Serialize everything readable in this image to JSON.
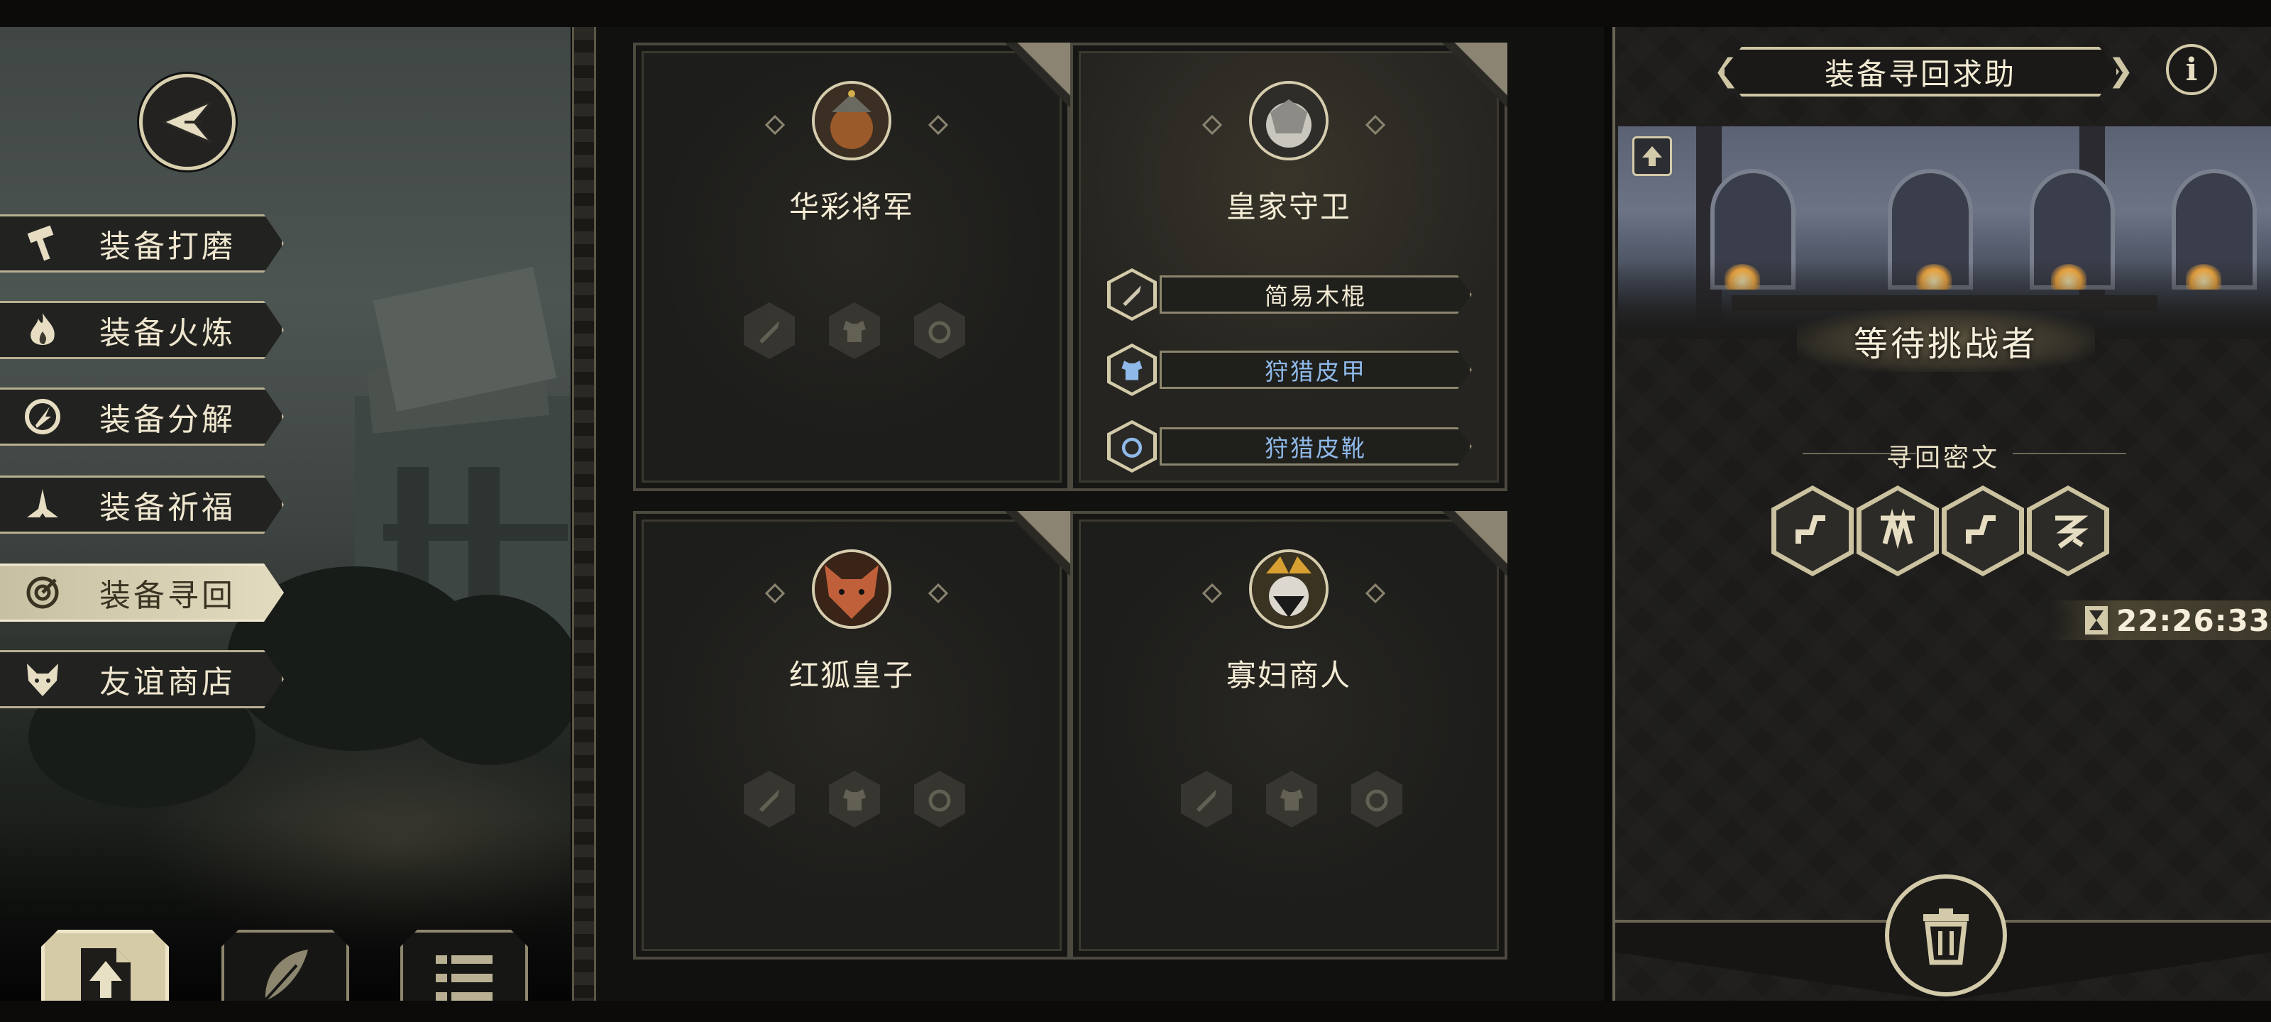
{
  "menu": {
    "items": [
      {
        "label": "装备打磨",
        "icon": "hammer-icon"
      },
      {
        "label": "装备火炼",
        "icon": "flame-icon"
      },
      {
        "label": "装备分解",
        "icon": "disassemble-icon"
      },
      {
        "label": "装备祈福",
        "icon": "praying-hands-icon"
      },
      {
        "label": "装备寻回",
        "icon": "retrieve-target-icon",
        "active": true
      },
      {
        "label": "友谊商店",
        "icon": "fox-head-icon"
      }
    ]
  },
  "bottom_tabs": [
    {
      "icon": "upload-document-icon",
      "active": true
    },
    {
      "icon": "feather-icon",
      "active": false
    },
    {
      "icon": "list-icon",
      "active": false
    }
  ],
  "characters": [
    {
      "name": "华彩将军",
      "portrait": "general-portrait-icon",
      "slots": [
        "sword-icon",
        "armor-icon",
        "boot-ring-icon"
      ],
      "equipment": []
    },
    {
      "name": "皇家守卫",
      "portrait": "royal-guard-portrait-icon",
      "selected": true,
      "equipment": [
        {
          "label": "简易木棍",
          "icon": "sword-icon",
          "rarity": "white"
        },
        {
          "label": "狩猎皮甲",
          "icon": "armor-icon",
          "rarity": "blue"
        },
        {
          "label": "狩猎皮靴",
          "icon": "boot-ring-icon",
          "rarity": "blue"
        }
      ]
    },
    {
      "name": "红狐皇子",
      "portrait": "red-fox-portrait-icon",
      "slots": [
        "sword-icon",
        "armor-icon",
        "boot-ring-icon"
      ],
      "equipment": []
    },
    {
      "name": "寡妇商人",
      "portrait": "widow-merchant-portrait-icon",
      "slots": [
        "sword-icon",
        "armor-icon",
        "boot-ring-icon"
      ],
      "equipment": []
    }
  ],
  "right_panel": {
    "title": "装备寻回求助",
    "info_icon": "info-icon",
    "status": "等待挑战者",
    "section_title": "寻回密文",
    "runes": [
      "rune-1-icon",
      "rune-2-icon",
      "rune-3-icon",
      "rune-4-icon"
    ],
    "timer": "22:26:33",
    "timer_icon": "hourglass-icon",
    "trash_icon": "trash-icon"
  },
  "colors": {
    "accent_gold": "#d3caa9",
    "blue_rarity": "#8fb9e8",
    "white_rarity": "#f3ebd4",
    "active_tab": "#d5cba7"
  }
}
